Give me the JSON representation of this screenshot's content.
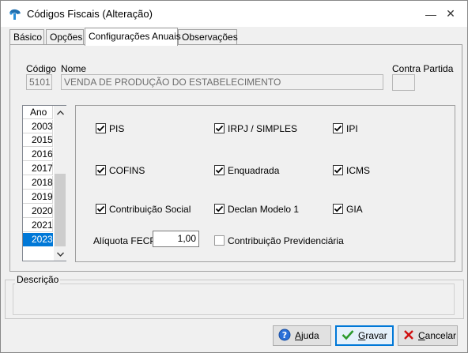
{
  "window": {
    "title": "Códigos Fiscais (Alteração)",
    "minimize": "—",
    "close": "✕"
  },
  "tabs": [
    {
      "label": "Básico"
    },
    {
      "label": "Opções"
    },
    {
      "label": "Configurações Anuais"
    },
    {
      "label": "Observações"
    }
  ],
  "header": {
    "codigo_label": "Código",
    "codigo_value": "5101",
    "nome_label": "Nome",
    "nome_value": "VENDA DE PRODUÇÃO DO ESTABELECIMENTO",
    "contra_partida_label": "Contra Partida",
    "contra_partida_value": ""
  },
  "year_list": {
    "header": "Ano",
    "years": [
      "2003",
      "2015",
      "2016",
      "2017",
      "2018",
      "2019",
      "2020",
      "2021",
      "2023"
    ],
    "selected": "2023"
  },
  "options": {
    "pis": {
      "label": "PIS",
      "checked": true
    },
    "irpj": {
      "label": "IRPJ / SIMPLES",
      "checked": true
    },
    "ipi": {
      "label": "IPI",
      "checked": true
    },
    "cofins": {
      "label": "COFINS",
      "checked": true
    },
    "enquadrada": {
      "label": "Enquadrada",
      "checked": true
    },
    "icms": {
      "label": "ICMS",
      "checked": true
    },
    "contribuicao_social": {
      "label": "Contribuição Social",
      "checked": true
    },
    "declan": {
      "label": "Declan Modelo 1",
      "checked": true
    },
    "gia": {
      "label": "GIA",
      "checked": true
    },
    "contribuicao_previdenciaria": {
      "label": "Contribuição Previdenciária",
      "checked": false
    },
    "aliquota_fecp_label": "Alíquota FECP",
    "aliquota_fecp_value": "1,00"
  },
  "descricao": {
    "label": "Descrição",
    "value": ""
  },
  "buttons": {
    "ajuda_first": "A",
    "ajuda_rest": "juda",
    "gravar_first": "G",
    "gravar_rest": "ravar",
    "cancelar_first": "C",
    "cancelar_rest": "ancelar"
  },
  "colors": {
    "selection": "#0078d7",
    "default_button_border": "#0078d7",
    "cancel_x": "#d01010",
    "check_green": "#2c9a2c"
  }
}
